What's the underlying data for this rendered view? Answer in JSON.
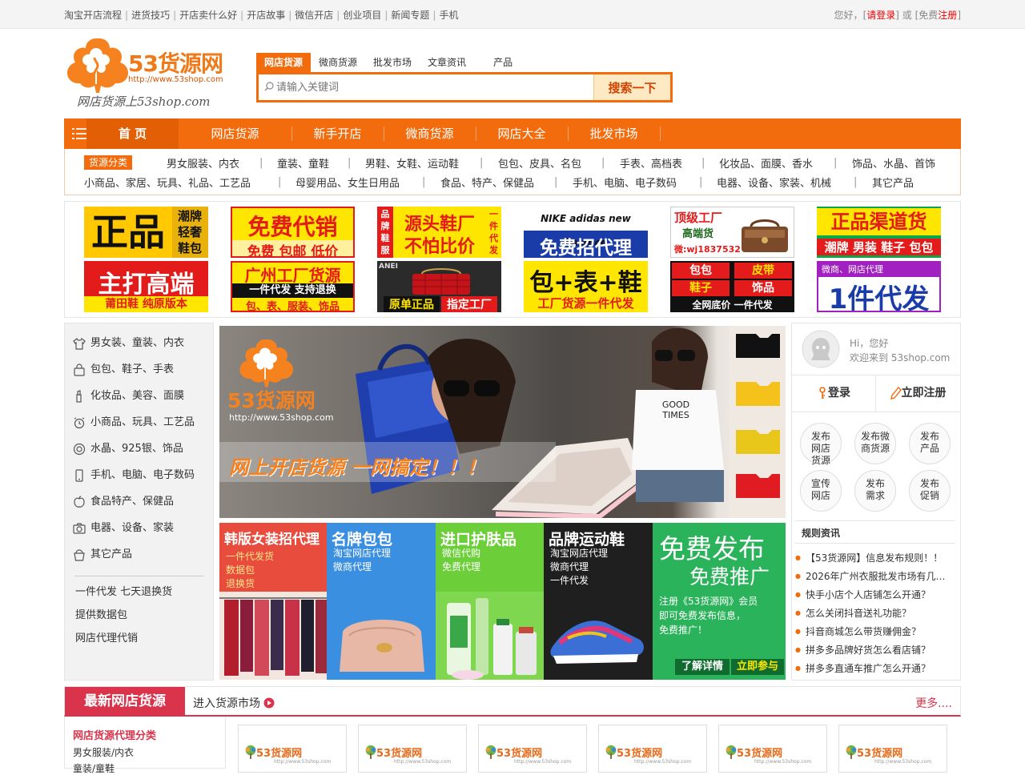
{
  "topbar": {
    "links": [
      "淘宝开店流程",
      "进货技巧",
      "开店卖什么好",
      "开店故事",
      "微信开店",
      "创业项目",
      "新闻专题",
      "手机"
    ],
    "greeting": "您好，",
    "login": "请登录",
    "or": "或",
    "register_prefix": "免费",
    "register": "注册"
  },
  "logo": {
    "brand": "53货源网",
    "url": "http://www.53shop.com",
    "slogan": "网店货源上53shop.com"
  },
  "search": {
    "tabs": [
      "网店货源",
      "微商货源",
      "批发市场",
      "文章资讯",
      "产品"
    ],
    "active_tab": 0,
    "placeholder": "请输入关键词",
    "button": "搜索一下"
  },
  "nav": {
    "items": [
      "首 页",
      "网店货源",
      "新手开店",
      "微商货源",
      "网店大全",
      "批发市场"
    ]
  },
  "categories": {
    "badge": "货源分类",
    "row1": [
      "男女服装、内衣",
      "童装、童鞋",
      "男鞋、女鞋、运动鞋",
      "包包、皮具、名包",
      "手表、高档表",
      "化妆品、面膜、香水",
      "饰品、水晶、首饰"
    ],
    "row2": [
      "小商品、家居、玩具、礼品、工艺品",
      "母婴用品、女生日用品",
      "食品、特产、保健品",
      "手机、电脑、电子数码",
      "电器、设备、家装、机械",
      "其它产品"
    ]
  },
  "ads": [
    {
      "main": "正品",
      "side": "潮牌轻奢鞋包"
    },
    {
      "main": "免费代销",
      "sub": "免费 包邮 低价"
    },
    {
      "main": "源头鞋厂",
      "sub": "不怕比价",
      "left": "品牌鞋服",
      "right": "一件代发"
    },
    {
      "logos": "NIKE adidas new balance",
      "sub": "免费招代理"
    },
    {
      "main": "顶级工厂",
      "sub": "高端货",
      "wx": "微:wj1837532"
    },
    {
      "main": "正品渠道货",
      "sub": "潮牌 男装 鞋子 包包"
    },
    {
      "main": "主打高端",
      "sub": "莆田鞋  纯原版本"
    },
    {
      "main": "广州工厂货源",
      "sub": "一件代发  支持退换",
      "sub2": "包、表、服装、饰品"
    },
    {
      "main": "原单正品",
      "sub": "指定工厂",
      "tag": "ANEI"
    },
    {
      "main": "包+表+鞋",
      "sub": "工厂货源一件代发"
    },
    {
      "cells": [
        "包包",
        "皮带",
        "鞋子",
        "饰品"
      ],
      "sub": "全网底价  一件代发"
    },
    {
      "top": "微商、网店代理",
      "main": "1件代发"
    }
  ],
  "sidebar": {
    "items": [
      "男女装、童装、内衣",
      "包包、鞋子、手表",
      "化妆品、美容、面膜",
      "小商品、玩具、工艺品",
      "水晶、925银、饰品",
      "手机、电脑、电子数码",
      "食品特产、保健品",
      "电器、设备、家装",
      "其它产品"
    ],
    "extras": [
      "一件代发 七天退换货",
      "提供数据包",
      "网店代理代销"
    ]
  },
  "banner": {
    "brand": "53货源网",
    "url": "http://www.53shop.com",
    "slogan": "网上开店货源 一网搞定！！！",
    "shirt": "GOOD TIMES"
  },
  "tiles": [
    {
      "title": "韩版女装招代理",
      "lines": [
        "一件代发货",
        "数据包",
        "退换货"
      ],
      "color": "#e84c3d"
    },
    {
      "title": "名牌包包",
      "lines": [
        "淘宝网店代理",
        "微商代理"
      ],
      "color": "#3b8fe0"
    },
    {
      "title": "进口护肤品",
      "lines": [
        "微信代购",
        "免费代理"
      ],
      "color": "#6ccf3a"
    },
    {
      "title": "品牌运动鞋",
      "lines": [
        "淘宝网店代理",
        "微商代理",
        "一件代发"
      ],
      "color": "#1f1f1f"
    },
    {
      "title": "免费发布",
      "title2": "免费推广",
      "lines": [
        "注册《53货源网》会员",
        "即可免费发布信息，",
        "免费推广！"
      ],
      "btn1": "了解详情",
      "btn2": "立即参与",
      "color": "#2ab35a"
    }
  ],
  "user": {
    "hi": "Hi，您好",
    "welcome": "欢迎来到 53shop.com",
    "login": "登录",
    "register": "立即注册"
  },
  "quick": [
    "发布网店货源",
    "发布微商货源",
    "发布产品",
    "宣传网店",
    "发布需求",
    "发布促销"
  ],
  "rules": {
    "title": "规则资讯",
    "items": [
      "【53货源网】信息发布规则！！",
      "2026年广州衣服批发市场有几个…",
      "快手小店个人店铺怎么开通？",
      "怎么关闭抖音送礼功能？",
      "抖音商城怎么带货赚佣金？",
      "拼多多品牌好货怎么看店铺？",
      "拼多多直通车推广怎么开通？"
    ]
  },
  "section": {
    "title": "最新网店货源",
    "enter": "进入货源市场",
    "more": "更多....",
    "cat_title": "网店货源代理分类",
    "cats": [
      "男女服装/内衣",
      "童装/童鞋"
    ]
  },
  "products": [
    {
      "logo": "53货源网",
      "url": "http://www.53shop.com"
    },
    {
      "logo": "53货源网",
      "url": "http://www.53shop.com"
    },
    {
      "logo": "53货源网",
      "url": "http://www.53shop.com"
    },
    {
      "logo": "53货源网",
      "url": "http://www.53shop.com"
    },
    {
      "logo": "53货源网",
      "url": "http://www.53shop.com"
    },
    {
      "logo": "53货源网",
      "url": "http://www.53shop.com"
    }
  ],
  "colors": {
    "accent": "#f26c0d",
    "section_red": "#d9344b"
  }
}
